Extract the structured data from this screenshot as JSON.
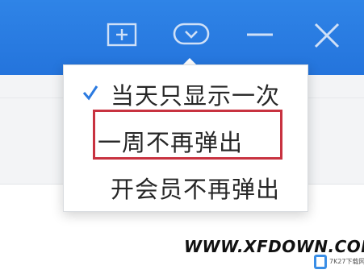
{
  "title_bar": {
    "icons": [
      "add-window-icon",
      "message-bubble-icon",
      "minimize-icon",
      "close-icon"
    ],
    "background": "#2a7de3"
  },
  "popup": {
    "items": [
      {
        "label": "当天只显示一次",
        "checked": true
      },
      {
        "label": "一周不再弹出",
        "checked": false,
        "highlighted": true
      },
      {
        "label": "开会员不再弹出",
        "checked": false
      }
    ],
    "check_color": "#2b7ae0",
    "highlight_color": "#c83240"
  },
  "watermark": {
    "text": "WWW.XFDOWN.COM",
    "logo_text": "7K27下载网"
  }
}
